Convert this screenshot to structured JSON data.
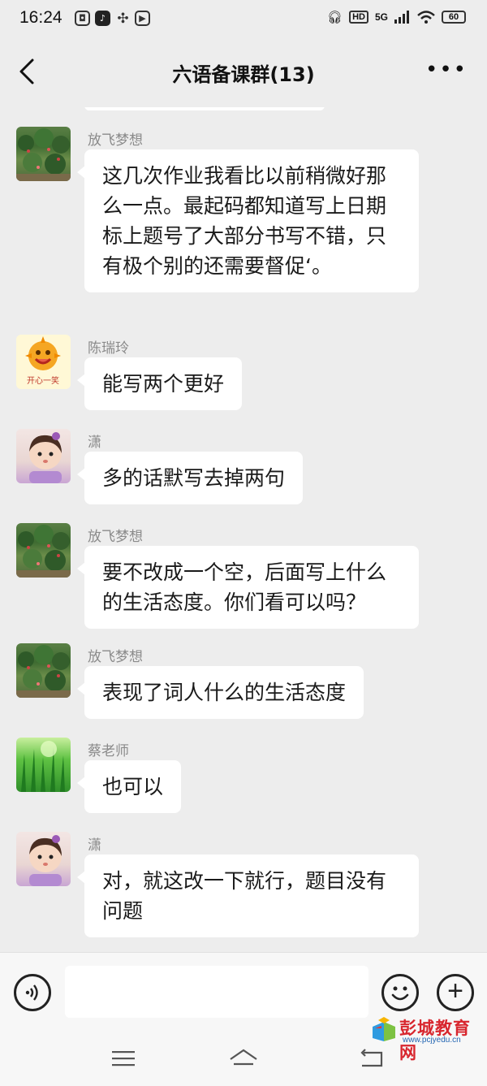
{
  "status_bar": {
    "time": "16:24",
    "network": "5G",
    "hd": "HD",
    "battery": "60"
  },
  "header": {
    "title": "六语备课群(13)"
  },
  "messages": [
    {
      "sender": "放飞梦想",
      "text": "这几次作业我看比以前稍微好那么一点。最起码都知道写上日期标上题号了大部分书写不错，只有极个别的还需要督促‘。",
      "avatar": "garden-avatar"
    },
    {
      "sender": "陈瑞玲",
      "text": "能写两个更好",
      "avatar": "sun-avatar",
      "avatar_text": "开心一笑"
    },
    {
      "sender": "潇",
      "text": "多的话默写去掉两句",
      "avatar": "girl-avatar"
    },
    {
      "sender": "放飞梦想",
      "text": "要不改成一个空，后面写上什么的生活态度。你们看可以吗？",
      "avatar": "garden-avatar"
    },
    {
      "sender": "放飞梦想",
      "text": "表现了词人什么的生活态度",
      "avatar": "garden-avatar"
    },
    {
      "sender": "蔡老师",
      "text": "也可以",
      "avatar": "green-avatar"
    },
    {
      "sender": "潇",
      "text": "对，就这改一下就行，题目没有问题",
      "avatar": "girl-avatar"
    }
  ],
  "input": {
    "placeholder": ""
  },
  "watermark": {
    "title": "彭城教育网",
    "url": "www.pcjyedu.cn"
  },
  "colors": {
    "background": "#ededed",
    "bubble": "#ffffff",
    "sender": "#8a8a8a"
  }
}
